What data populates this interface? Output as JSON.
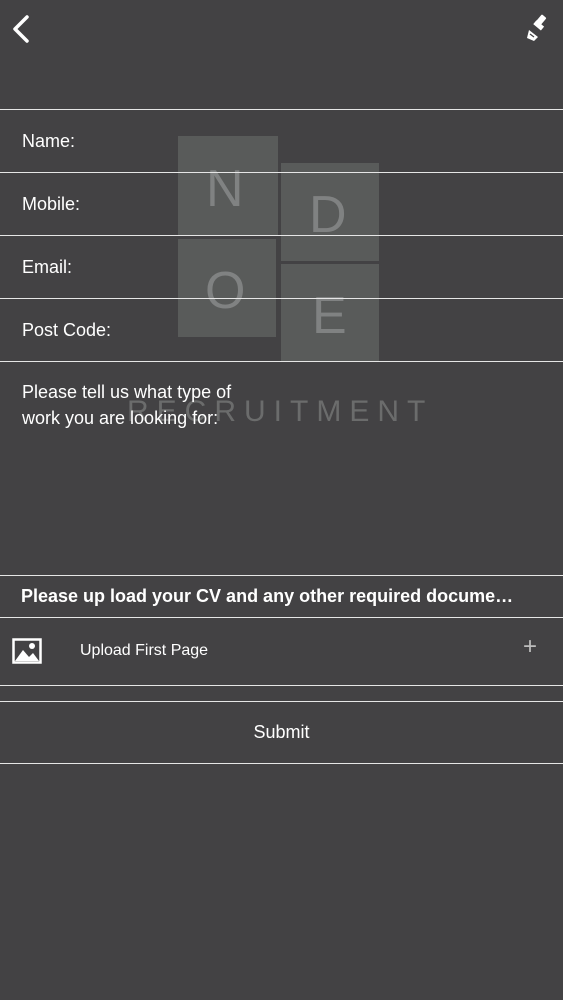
{
  "header": {
    "back_icon": "chevron-left-icon",
    "brush_icon": "paint-brush-icon"
  },
  "watermark": {
    "letters": [
      "N",
      "D",
      "O",
      "E"
    ],
    "word": "RECRUITMENT"
  },
  "form": {
    "fields": [
      {
        "label": "Name:"
      },
      {
        "label": "Mobile:"
      },
      {
        "label": "Email:"
      },
      {
        "label": "Post Code:"
      }
    ],
    "work_prompt": "Please tell us what type of work you are looking for:",
    "upload_section_title": "Please up load your CV and any other required docume…",
    "upload": {
      "icon": "image-icon",
      "label": "Upload First Page",
      "plus": "+"
    },
    "submit_label": "Submit"
  }
}
